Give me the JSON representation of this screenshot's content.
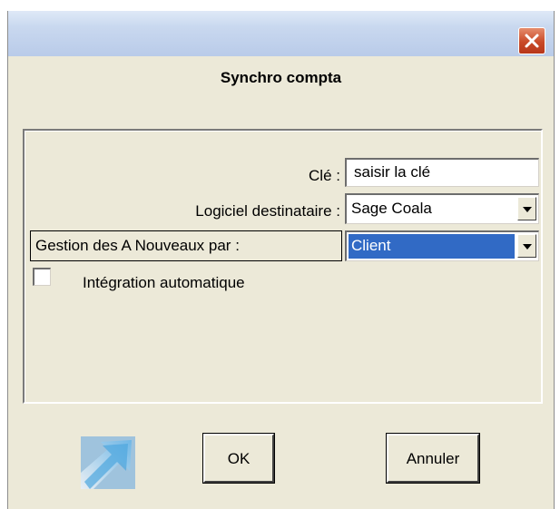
{
  "dialog": {
    "title": "Synchro compta"
  },
  "form": {
    "cle_label": "Clé :",
    "cle_value": "saisir la clé",
    "logiciel_label": "Logiciel destinataire :",
    "logiciel_value": "Sage Coala",
    "gestion_label": "Gestion des A Nouveaux par :",
    "gestion_value": "Client",
    "integration_label": "Intégration automatique",
    "integration_checked": false
  },
  "buttons": {
    "ok_label": "OK",
    "cancel_label": "Annuler"
  },
  "icons": {
    "close": "close-icon",
    "app": "arrow-logo-icon",
    "dropdown": "chevron-down-icon"
  },
  "colors": {
    "window_bg": "#ece9d8",
    "selection": "#316ac5",
    "close_button": "#c94a28"
  }
}
